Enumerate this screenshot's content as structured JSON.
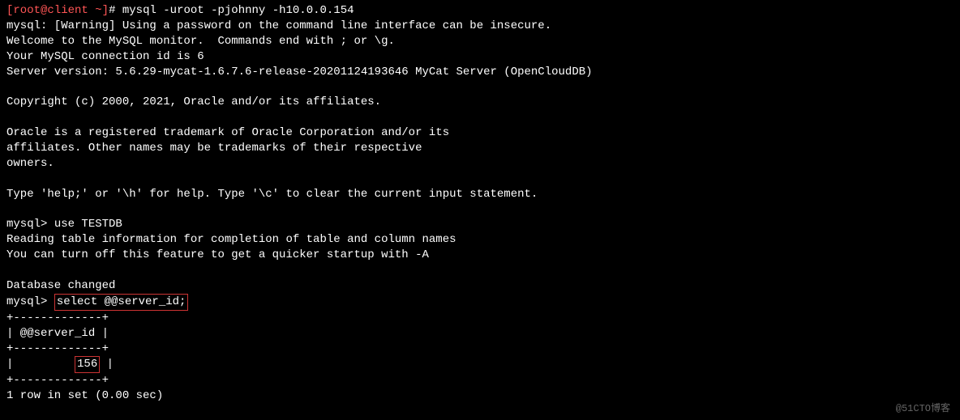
{
  "prompt": {
    "open_bracket": "[",
    "user": "root",
    "at": "@",
    "host": "client",
    "path": " ~",
    "close_bracket": "]",
    "hash": "# "
  },
  "shell_command": "mysql -uroot -pjohnny -h10.0.0.154",
  "output": {
    "warning": "mysql: [Warning] Using a password on the command line interface can be insecure.",
    "welcome": "Welcome to the MySQL monitor.  Commands end with ; or \\g.",
    "conn_id": "Your MySQL connection id is 6",
    "server_version": "Server version: 5.6.29-mycat-1.6.7.6-release-20201124193646 MyCat Server (OpenCloudDB)",
    "blank1": "",
    "copyright": "Copyright (c) 2000, 2021, Oracle and/or its affiliates.",
    "blank2": "",
    "trademark1": "Oracle is a registered trademark of Oracle Corporation and/or its",
    "trademark2": "affiliates. Other names may be trademarks of their respective",
    "trademark3": "owners.",
    "blank3": "",
    "help": "Type 'help;' or '\\h' for help. Type '\\c' to clear the current input statement.",
    "blank4": ""
  },
  "mysql": {
    "prompt": "mysql> ",
    "cmd_use": "use TESTDB",
    "reading_info": "Reading table information for completion of table and column names",
    "turn_off": "You can turn off this feature to get a quicker startup with -A",
    "blank5": "",
    "db_changed": "Database changed",
    "cmd_select": "select @@server_id;",
    "table_top": "+-------------+",
    "table_header": "| @@server_id |",
    "table_mid": "+-------------+",
    "table_row_prefix": "|         ",
    "table_row_value": "156",
    "table_row_suffix": " |",
    "table_bot": "+-------------+",
    "result": "1 row in set (0.00 sec)"
  },
  "watermark": "@51CTO博客"
}
